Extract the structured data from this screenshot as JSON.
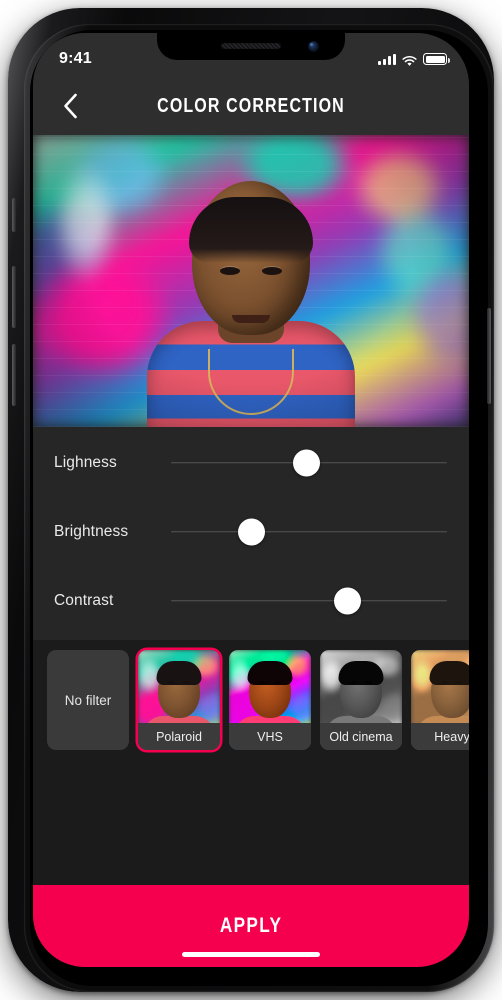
{
  "statusbar": {
    "time": "9:41",
    "signal_icon": "cellular-signal-icon",
    "wifi_icon": "wifi-icon",
    "battery_icon": "battery-full-icon"
  },
  "header": {
    "back_icon": "chevron-left-icon",
    "title": "COLOR CORRECTION"
  },
  "photo": {
    "name": "photo-preview",
    "description": "Portrait of a man in a pink and blue striped shirt in front of a colorful graffiti wall"
  },
  "sliders": [
    {
      "label": "Lighness",
      "value_percent": 49
    },
    {
      "label": "Brightness",
      "value_percent": 29
    },
    {
      "label": "Contrast",
      "value_percent": 64
    }
  ],
  "filters": {
    "items": [
      {
        "label": "No filter",
        "selected": false,
        "style": "none"
      },
      {
        "label": "Polaroid",
        "selected": true,
        "style": "polaroid"
      },
      {
        "label": "VHS",
        "selected": false,
        "style": "vhs"
      },
      {
        "label": "Old cinema",
        "selected": false,
        "style": "oldcinema"
      },
      {
        "label": "Heavy",
        "selected": false,
        "style": "heavy"
      }
    ]
  },
  "footer": {
    "apply_label": "APPLY"
  },
  "colors": {
    "accent": "#f5004f",
    "screen_bg": "#212121",
    "panel_bg": "#262626",
    "filter_strip_bg": "#1b1b1b",
    "navbar_bg": "#2e2e2e",
    "tile_bg": "#3a3a3a"
  }
}
